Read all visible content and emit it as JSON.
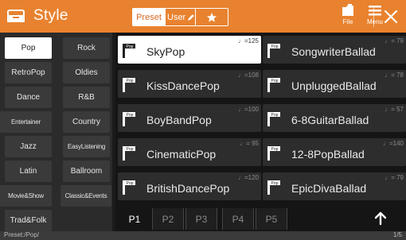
{
  "header": {
    "title": "Style",
    "icon": "style-icon",
    "tabs": {
      "preset": "Preset",
      "user": "User"
    },
    "file_label": "File",
    "menu_label": "Menu",
    "accent": "#e8822f"
  },
  "categories": [
    {
      "label": "Pop",
      "selected": true
    },
    {
      "label": "Rock"
    },
    {
      "label": "RetroPop"
    },
    {
      "label": "Oldies"
    },
    {
      "label": "Dance"
    },
    {
      "label": "R&B"
    },
    {
      "label": "Entertainer"
    },
    {
      "label": "Country"
    },
    {
      "label": "Jazz"
    },
    {
      "label": "EasyListening"
    },
    {
      "label": "Latin"
    },
    {
      "label": "Ballroom"
    },
    {
      "label": "Movie&Show"
    },
    {
      "label": "Classic&Events"
    },
    {
      "label": "Trad&Folk"
    }
  ],
  "styles": [
    {
      "name": "SkyPop",
      "tempo": "♩=125",
      "selected": true
    },
    {
      "name": "SongwriterBallad",
      "tempo": "♩= 79"
    },
    {
      "name": "KissDancePop",
      "tempo": "♩=108"
    },
    {
      "name": "UnpluggedBallad",
      "tempo": "♩= 78"
    },
    {
      "name": "BoyBandPop",
      "tempo": "♩=100"
    },
    {
      "name": "6-8GuitarBallad",
      "tempo": "♩= 57"
    },
    {
      "name": "CinematicPop",
      "tempo": "♩= 95"
    },
    {
      "name": "12-8PopBallad",
      "tempo": "♩=140"
    },
    {
      "name": "BritishDancePop",
      "tempo": "♩=120"
    },
    {
      "name": "EpicDivaBallad",
      "tempo": "♩= 79"
    }
  ],
  "preset_icon_text": "Pop",
  "pages": [
    {
      "label": "P1",
      "selected": true
    },
    {
      "label": "P2"
    },
    {
      "label": "P3"
    },
    {
      "label": "P4"
    },
    {
      "label": "P5"
    }
  ],
  "status": {
    "path": "Preset:/Pop/",
    "page": "1/5"
  }
}
